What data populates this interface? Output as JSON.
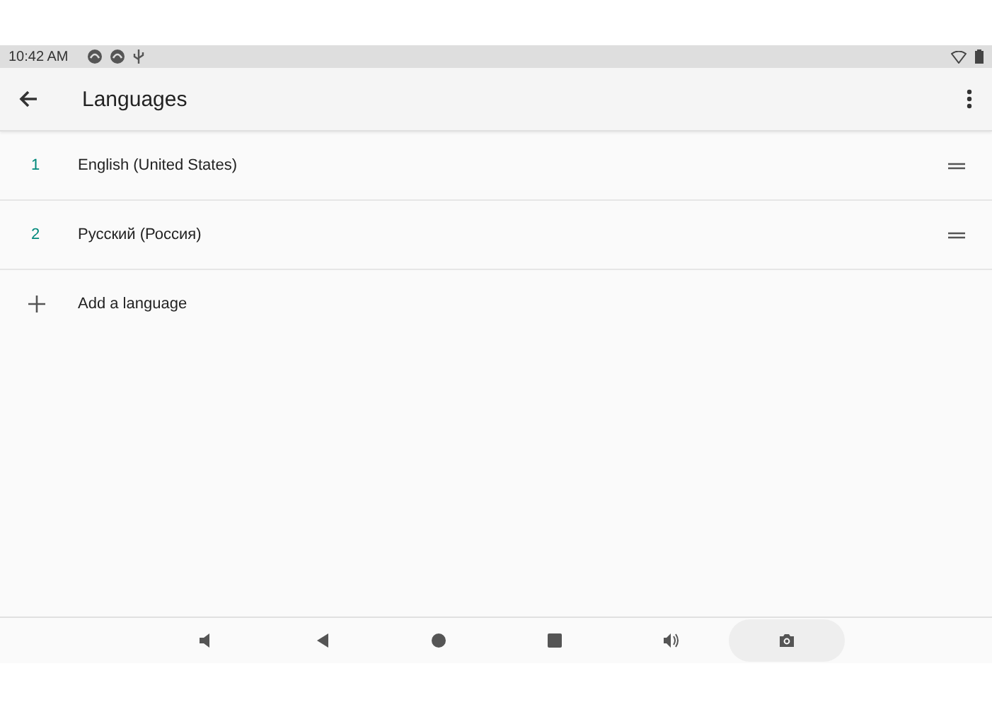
{
  "status_bar": {
    "time": "10:42 AM"
  },
  "app_bar": {
    "title": "Languages"
  },
  "languages": [
    {
      "number": "1",
      "name": "English (United States)"
    },
    {
      "number": "2",
      "name": "Русский (Россия)"
    }
  ],
  "add_action": {
    "label": "Add a language"
  },
  "nav_bar": {
    "buttons": [
      {
        "kind": "volume-down",
        "selected": false
      },
      {
        "kind": "back",
        "selected": false
      },
      {
        "kind": "home",
        "selected": false
      },
      {
        "kind": "recents",
        "selected": false
      },
      {
        "kind": "volume-up",
        "selected": false
      },
      {
        "kind": "screenshot",
        "selected": true
      }
    ]
  }
}
